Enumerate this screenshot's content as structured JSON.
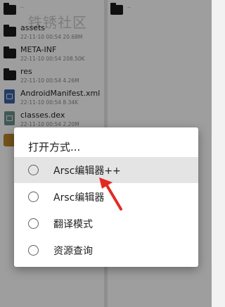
{
  "watermark": "铁锈社区",
  "left_pane": {
    "parent_label": "..",
    "files": [
      {
        "name": "assets",
        "meta": "22-11-10 00:54  20.68M",
        "icon": "folder-icon"
      },
      {
        "name": "META-INF",
        "meta": "22-11-10 00:54  208.50K",
        "icon": "folder-icon"
      },
      {
        "name": "res",
        "meta": "22-11-10 00:54  4.26M",
        "icon": "folder-icon"
      },
      {
        "name": "AndroidManifest.xml",
        "meta": "22-11-10 00:54  8.34K",
        "icon": "xml-file-icon"
      },
      {
        "name": "classes.dex",
        "meta": "22-11-10 00:54  2.20M",
        "icon": "dex-file-icon"
      }
    ]
  },
  "right_pane": {
    "parent_label": ".."
  },
  "dialog": {
    "title": "打开方式...",
    "options": [
      {
        "label": "Arsc编辑器++",
        "selected": true
      },
      {
        "label": "Arsc编辑器",
        "selected": false
      },
      {
        "label": "翻译模式",
        "selected": false
      },
      {
        "label": "资源查询",
        "selected": false
      }
    ]
  },
  "colors": {
    "annotation_arrow": "#e32a22",
    "selected_row": "#e4e4e4",
    "xml_icon": "#3a5fa3",
    "package_icon": "#b8862e"
  }
}
